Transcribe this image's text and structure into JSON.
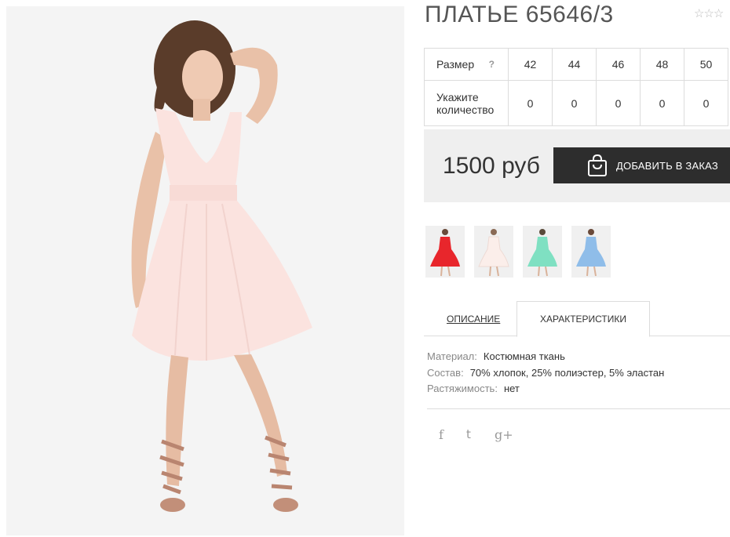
{
  "product": {
    "title": "ПЛАТЬЕ 65646/3",
    "rating_stars": "☆☆☆"
  },
  "size_table": {
    "size_label": "Размер",
    "help": "?",
    "sizes": [
      "42",
      "44",
      "46",
      "48",
      "50"
    ],
    "quantity_label": "Укажите количество",
    "quantities": [
      "0",
      "0",
      "0",
      "0",
      "0"
    ]
  },
  "purchase": {
    "price": "1500 руб",
    "add_to_order": "ДОБАВИТЬ В ЗАКАЗ"
  },
  "thumbnails": [
    {
      "color": "#e8262c",
      "name": "red"
    },
    {
      "color": "#f9ebe8",
      "name": "pale-pink"
    },
    {
      "color": "#7fe0c2",
      "name": "mint"
    },
    {
      "color": "#8fbde9",
      "name": "blue"
    }
  ],
  "tabs": {
    "description": "ОПИСАНИЕ",
    "characteristics": "ХАРАКТЕРИСТИКИ"
  },
  "specs": [
    {
      "key": "Материал:",
      "value": "Костюмная ткань"
    },
    {
      "key": "Состав:",
      "value": "70% хлопок, 25% полиэстер, 5% эластан"
    },
    {
      "key": "Растяжимость:",
      "value": "нет"
    }
  ],
  "social": {
    "facebook": "f",
    "twitter": "t",
    "google": "g+"
  },
  "colors": {
    "dress": "#fbe3df",
    "button_bg": "#2d2d2d",
    "price_box_bg": "#efefef"
  }
}
